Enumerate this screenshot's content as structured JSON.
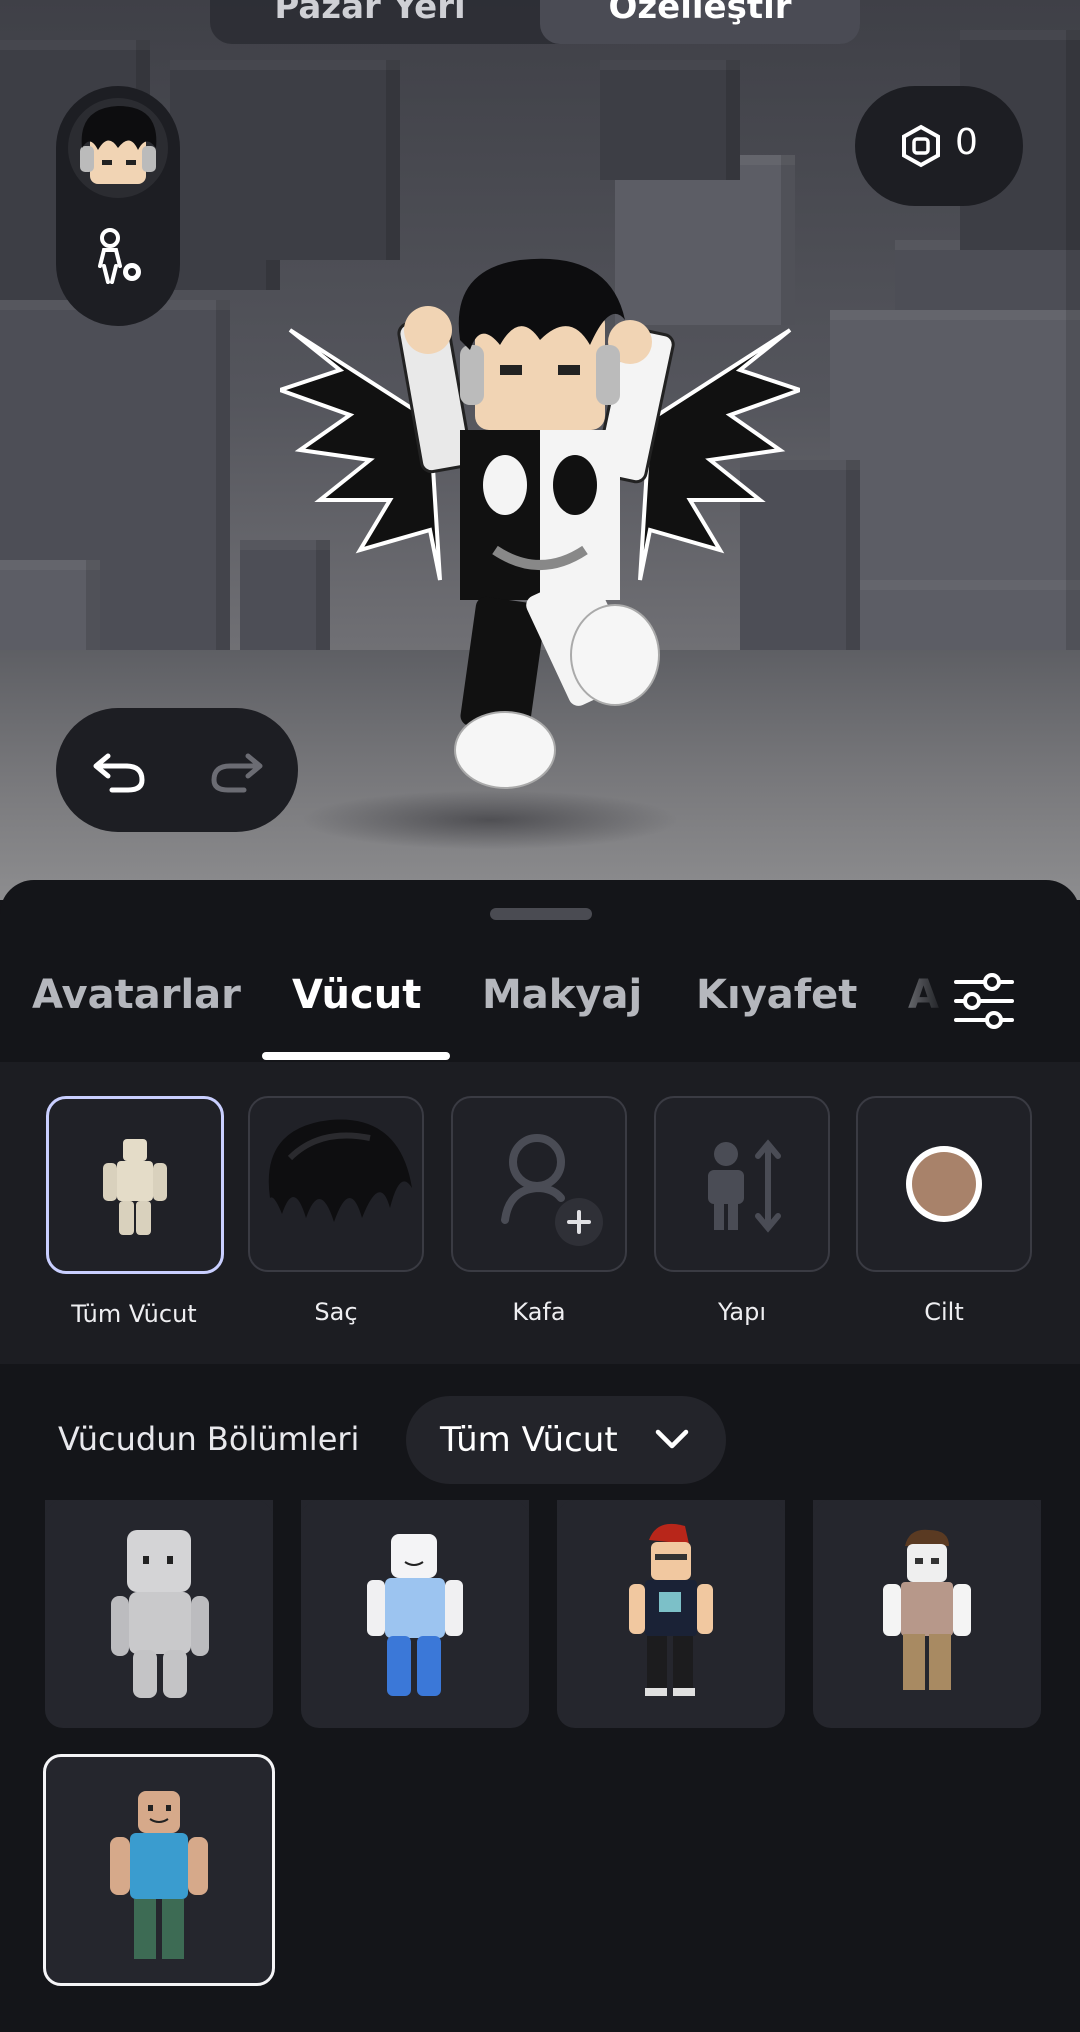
{
  "header": {
    "segments": [
      {
        "label": "Pazar Yeri",
        "active": false
      },
      {
        "label": "Özelleştir",
        "active": true
      }
    ],
    "robux": {
      "icon": "robux-icon",
      "count": "0"
    }
  },
  "scene": {
    "undo_icon": "undo-icon",
    "redo_icon": "redo-icon",
    "redo_enabled": false
  },
  "tabs": [
    {
      "label": "Avatarlar",
      "active": false
    },
    {
      "label": "Vücut",
      "active": true
    },
    {
      "label": "Makyaj",
      "active": false
    },
    {
      "label": "Kıyafet",
      "active": false
    },
    {
      "label": "A",
      "active": false
    }
  ],
  "filter_icon": "sliders-icon",
  "categories": [
    {
      "label": "Tüm Vücut",
      "icon": "full-body-icon",
      "selected": true
    },
    {
      "label": "Saç",
      "icon": "hair-icon",
      "selected": false
    },
    {
      "label": "Kafa",
      "icon": "add-head-icon",
      "selected": false
    },
    {
      "label": "Yapı",
      "icon": "body-scale-icon",
      "selected": false
    },
    {
      "label": "Cilt",
      "icon": "skin-color-icon",
      "selected": false,
      "color": "#a8826a"
    }
  ],
  "parts": {
    "label": "Vücudun Bölümleri",
    "selected": "Tüm Vücut"
  },
  "colors": {
    "accent_selection": "#c9cfff",
    "sheet_background": "#141519"
  }
}
